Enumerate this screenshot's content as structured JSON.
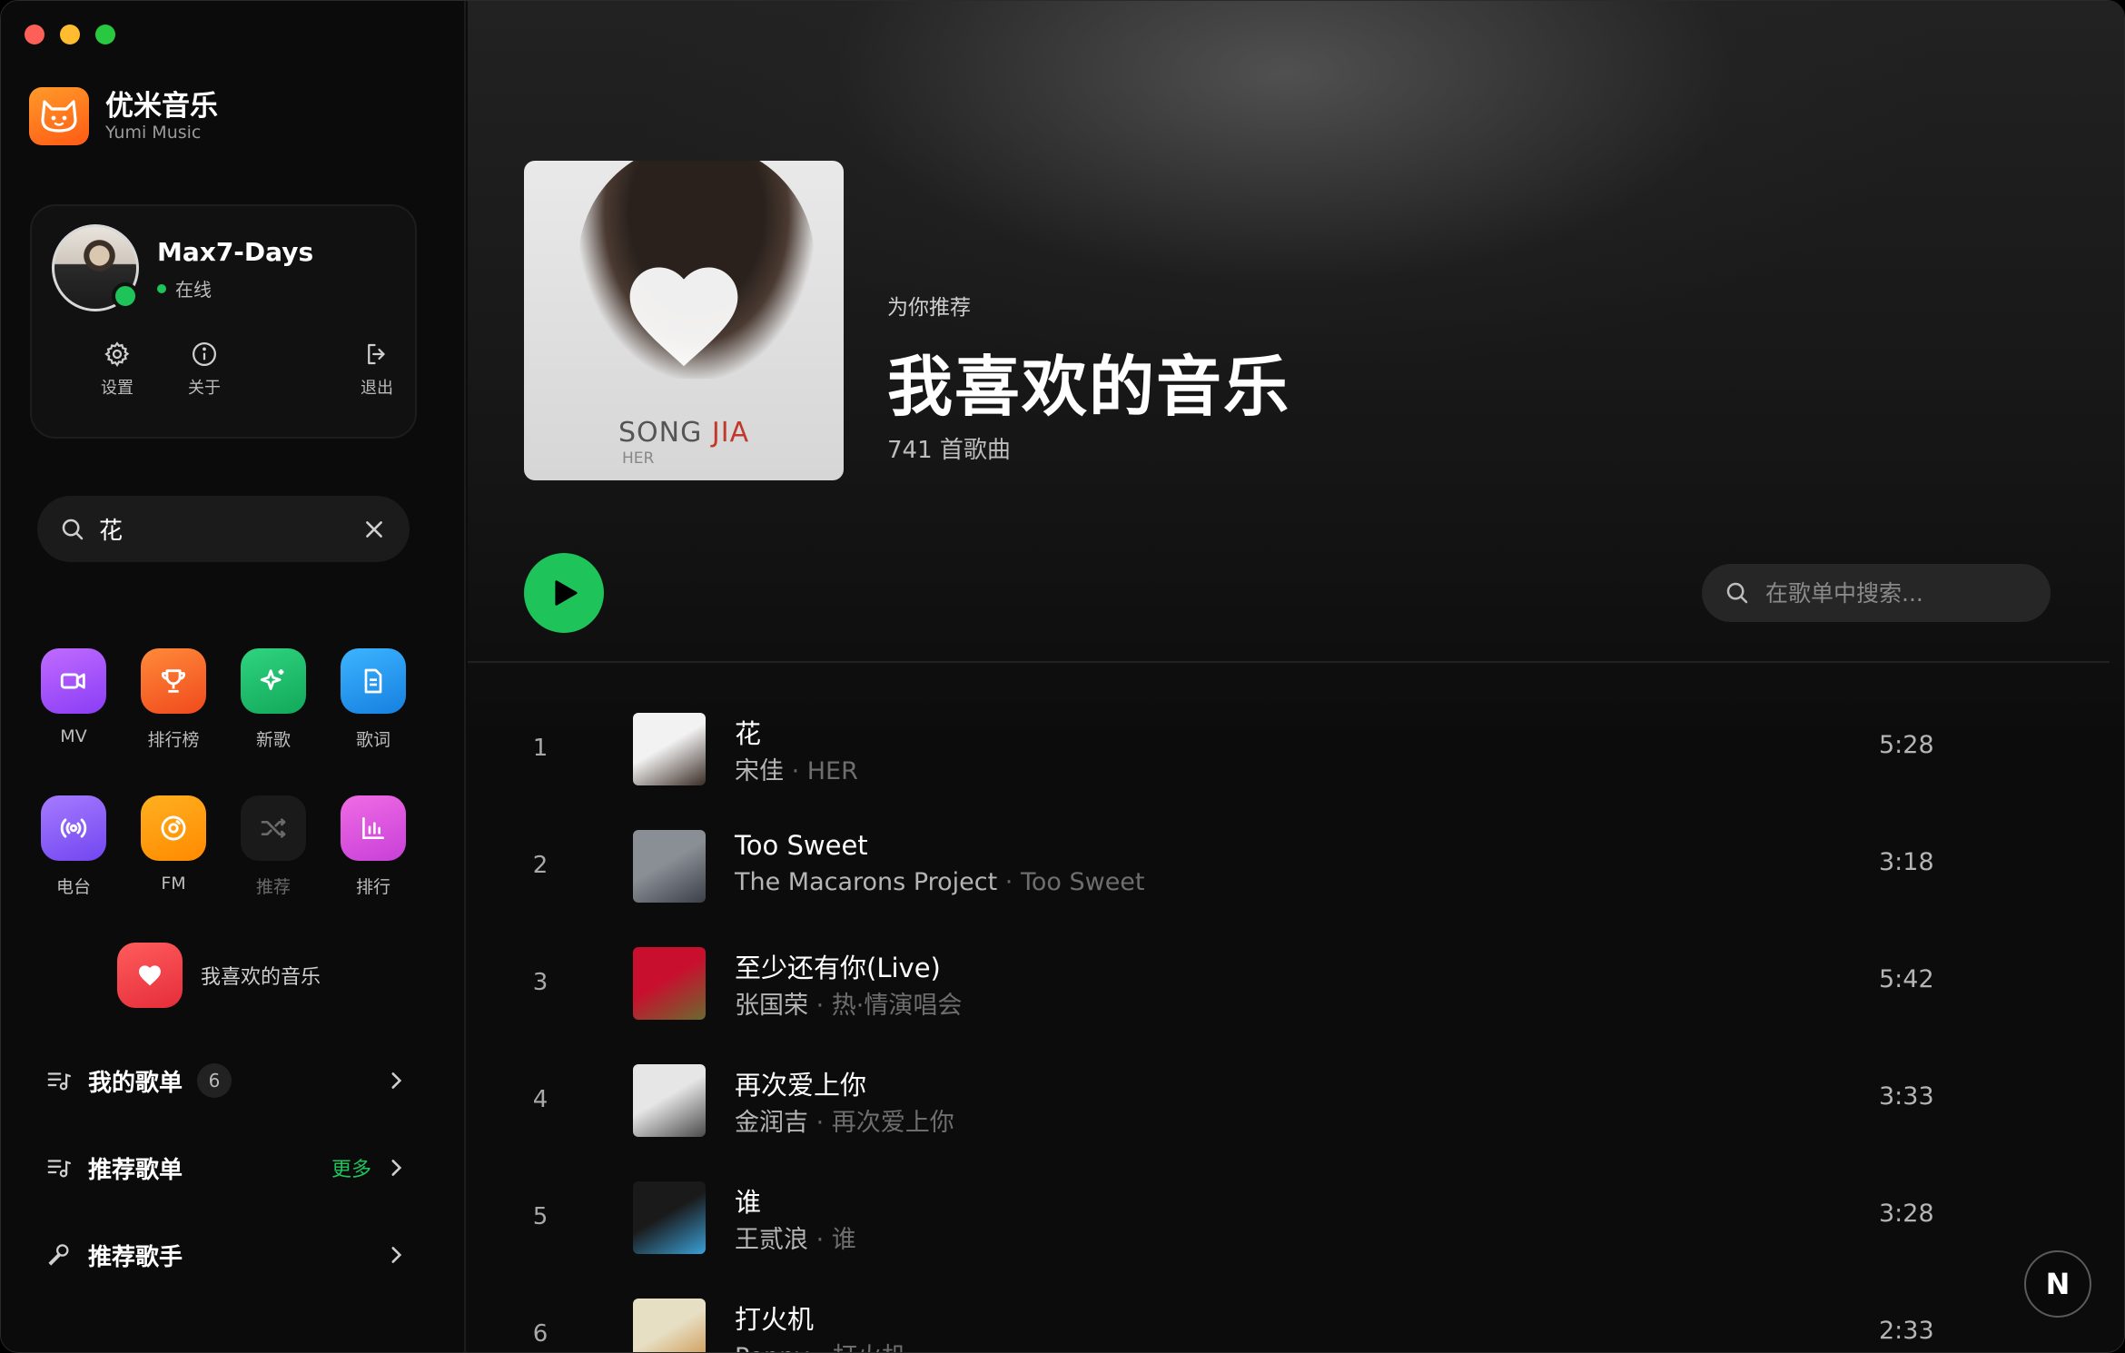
{
  "app": {
    "name": "优米音乐",
    "subtitle": "Yumi Music"
  },
  "user": {
    "name": "Max7-Days",
    "status": "在线",
    "actions": [
      {
        "label": "设置",
        "icon": "gear-icon"
      },
      {
        "label": "关于",
        "icon": "info-icon"
      },
      {
        "label": "退出",
        "icon": "logout-icon"
      }
    ]
  },
  "sidebar_search": {
    "value": "花"
  },
  "nav_grid": [
    {
      "label": "MV",
      "icon": "video-icon",
      "color": "#a64dff"
    },
    {
      "label": "排行榜",
      "icon": "trophy-icon",
      "color": "#ff6a1f"
    },
    {
      "label": "新歌",
      "icon": "sparkle-icon",
      "color": "#17c26d"
    },
    {
      "label": "歌词",
      "icon": "document-icon",
      "color": "#1e9bf0"
    },
    {
      "label": "电台",
      "icon": "broadcast-icon",
      "color": "#8b5cf6"
    },
    {
      "label": "FM",
      "icon": "disc-icon",
      "color": "#ff9a0f"
    },
    {
      "label": "推荐",
      "icon": "shuffle-icon",
      "color": "#1c1c1c"
    },
    {
      "label": "排行",
      "icon": "bar-chart-icon",
      "color": "#e05bd8"
    }
  ],
  "favorites": {
    "label": "我喜欢的音乐"
  },
  "side_rows": {
    "my_playlists": {
      "label": "我的歌单",
      "count": "6"
    },
    "recommended_playlists": {
      "label": "推荐歌单",
      "more": "更多"
    },
    "recommended_artists": {
      "label": "推荐歌手"
    }
  },
  "playlist": {
    "eyebrow": "为你推荐",
    "title": "我喜欢的音乐",
    "count": "741 首歌曲",
    "cover": {
      "title_a": "SONG ",
      "title_b": "JIA",
      "sub": "HER"
    }
  },
  "list_search": {
    "placeholder": "在歌单中搜索..."
  },
  "tracks": [
    {
      "num": "1",
      "name": "花",
      "artist": "宋佳",
      "album": "HER",
      "duration": "5:28",
      "art": [
        "#f2f2f2",
        "#3a2c25"
      ]
    },
    {
      "num": "2",
      "name": "Too Sweet",
      "artist": "The Macarons Project",
      "album": "Too Sweet",
      "duration": "3:18",
      "art": [
        "#8a8f96",
        "#3b4048"
      ]
    },
    {
      "num": "3",
      "name": "至少还有你(Live)",
      "artist": "张国荣",
      "album": "热·情演唱会",
      "duration": "5:42",
      "art": [
        "#c8102e",
        "#6a6a2e"
      ]
    },
    {
      "num": "4",
      "name": "再次爱上你",
      "artist": "金润吉",
      "album": "再次爱上你",
      "duration": "3:33",
      "art": [
        "#e6e6e6",
        "#4a4a4a"
      ]
    },
    {
      "num": "5",
      "name": "谁",
      "artist": "王贰浪",
      "album": "谁",
      "duration": "3:28",
      "art": [
        "#1a1a1a",
        "#3aa0d8"
      ]
    },
    {
      "num": "6",
      "name": "打火机",
      "artist": "Penny",
      "album": "打火机",
      "duration": "2:33",
      "art": [
        "#e7dfc4",
        "#c98a3a"
      ]
    }
  ],
  "fab": {
    "label": "N"
  }
}
